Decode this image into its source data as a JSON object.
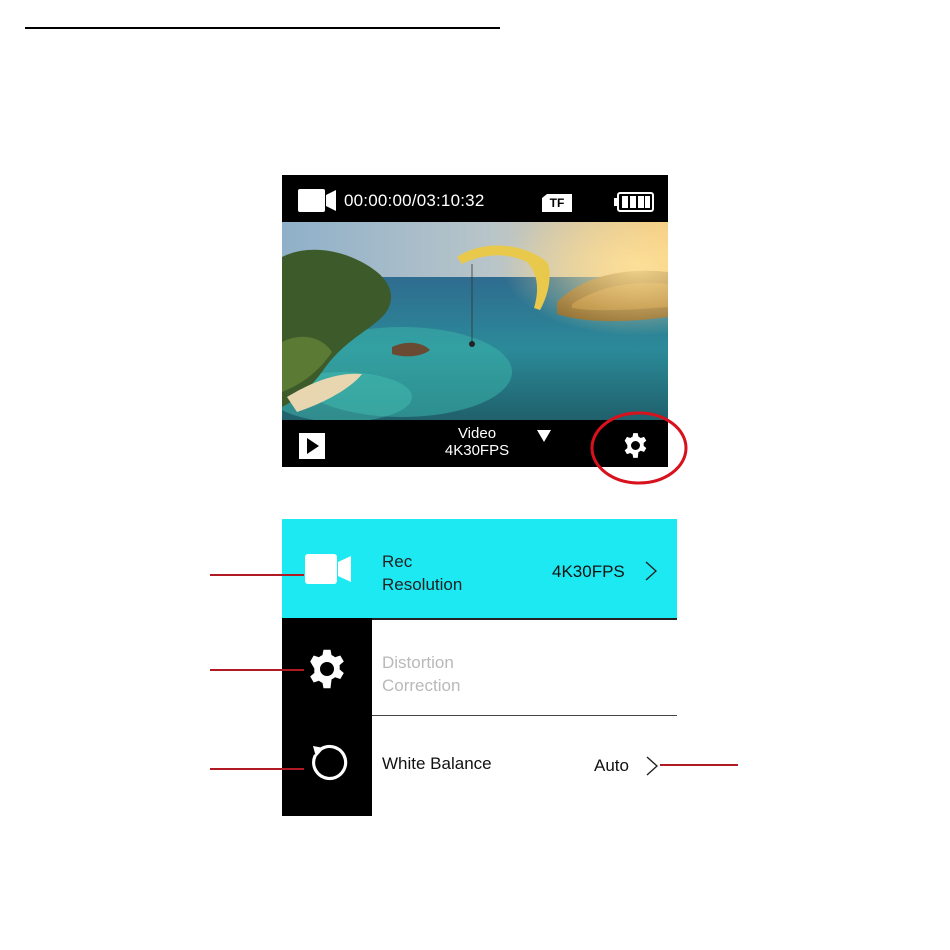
{
  "camera_screen": {
    "timecode": "00:00:00/03:10:32",
    "storage_badge": "TF",
    "mode_name": "Video",
    "mode_resolution": "4K30FPS",
    "icons": {
      "record_mode": "video-camera-icon",
      "storage": "sd-card-icon",
      "battery": "battery-full-icon",
      "playback": "play-icon",
      "mode_dropdown": "triangle-down-icon",
      "settings": "gear-icon"
    }
  },
  "settings_menu": {
    "rows": [
      {
        "label_line1": "Rec",
        "label_line2": "Resolution",
        "value": "4K30FPS",
        "state": "selected"
      },
      {
        "label_line1": "Distortion",
        "label_line2": "Correction",
        "value": "",
        "state": "disabled"
      },
      {
        "label_line1": "White Balance",
        "value": "Auto",
        "state": "normal"
      }
    ],
    "sidebar_icons": [
      "video-camera-icon",
      "gear-icon",
      "reset-icon"
    ]
  },
  "colors": {
    "selected_row": "#1de9f2",
    "callout": "#b11a22",
    "highlight_ring": "#d8121d",
    "disabled_text": "#b9b9b9"
  }
}
